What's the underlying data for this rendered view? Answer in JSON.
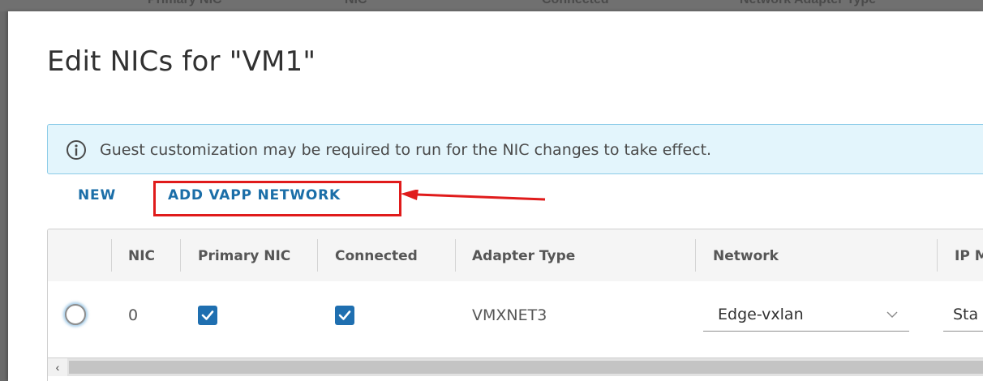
{
  "background_header": {
    "cells": [
      "Primary NIC",
      "NIC",
      "Connected",
      "Network Adapter Type"
    ]
  },
  "dialog": {
    "title": "Edit NICs for \"VM1\"",
    "info_message": "Guest customization may be required to run for the NIC changes to take effect.",
    "info_icon": "info-circle-icon",
    "actions": {
      "new_label": "NEW",
      "add_vapp_network_label": "ADD VAPP NETWORK"
    },
    "annotation": {
      "highlight_color": "#e01b1b",
      "arrow_color": "#e01b1b"
    },
    "table": {
      "columns": [
        "NIC",
        "Primary NIC",
        "Connected",
        "Adapter Type",
        "Network",
        "IP Mo"
      ],
      "rows": [
        {
          "selected": false,
          "nic": "0",
          "primary_nic": true,
          "connected": true,
          "adapter_type": "VMXNET3",
          "network": "Edge-vxlan",
          "ip_mode": "Sta"
        }
      ],
      "scroll_left_label": "‹"
    }
  },
  "colors": {
    "link": "#1b6ea8",
    "checkbox": "#1f6fb0",
    "info_bg": "#e3f5fc",
    "info_border": "#8ccce8"
  }
}
